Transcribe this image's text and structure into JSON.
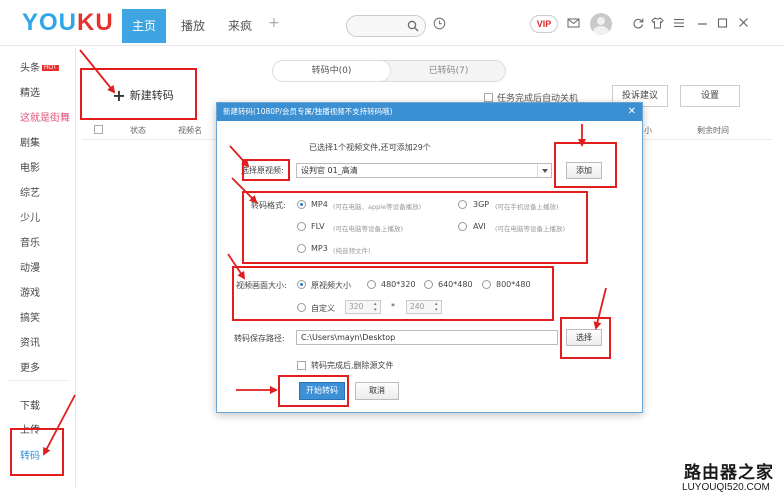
{
  "app": {
    "logo_main": "YOU",
    "logo_accent": "KU"
  },
  "nav": {
    "tabs": [
      "主页",
      "播放",
      "来疯"
    ],
    "plus": "+"
  },
  "topbar": {
    "vip": "VIP"
  },
  "sidebar": {
    "items": [
      "头条",
      "精选",
      "这就是街舞",
      "剧集",
      "电影",
      "综艺",
      "少儿",
      "音乐",
      "动漫",
      "游戏",
      "搞笑",
      "资讯",
      "更多",
      "下载",
      "上传",
      "转码"
    ],
    "hot_badge": "HOT"
  },
  "main": {
    "segment": [
      "转码中(0)",
      "已转码(7)"
    ],
    "new_button": "新建转码",
    "new_button_icon": "+",
    "auto_shutdown": "任务完成后自动关机",
    "feedback_button": "投诉建议",
    "settings_button": "设置",
    "columns": [
      "状态",
      "视频名",
      "小",
      "剩余时间"
    ]
  },
  "dialog": {
    "title": "新建转码(1080P/会员专属/独播视频不支持转码哦)",
    "close": "✕",
    "info": "已选择1个视频文件,还可添加29个",
    "source_label": "选择原视频:",
    "source_value": "设判官 01_高清",
    "add_button": "添加",
    "format_label": "转码格式:",
    "formats": [
      {
        "name": "MP4",
        "hint": "(可在电脑、apple等设备播放)"
      },
      {
        "name": "3GP",
        "hint": "(可在手机设备上播放)"
      },
      {
        "name": "FLV",
        "hint": "(可在电脑等设备上播放)"
      },
      {
        "name": "AVI",
        "hint": "(可在电脑等设备上播放)"
      },
      {
        "name": "MP3",
        "hint": "(纯音频文件)"
      }
    ],
    "selected_format": "MP4",
    "size_label": "视频画面大小:",
    "sizes": [
      "原视频大小",
      "480*320",
      "640*480",
      "800*480"
    ],
    "selected_size": "原视频大小",
    "custom_label": "自定义",
    "custom_width": "320",
    "custom_height": "240",
    "custom_sep": "*",
    "path_label": "转码保存路径:",
    "path_value": "C:\\Users\\mayn\\Desktop",
    "browse_button": "选择",
    "delete_source": "转码完成后,删除源文件",
    "start_button": "开始转码",
    "cancel_button": "取消"
  },
  "watermark": {
    "cn": "路由器之家",
    "url": "LUYOUQI520.COM"
  },
  "colors": {
    "accent": "#3ea4e2",
    "annotation": "#e11d1d",
    "dialog_title": "#3b8fd3",
    "logo_blue": "#2fa6e8",
    "logo_red": "#e5322d"
  }
}
